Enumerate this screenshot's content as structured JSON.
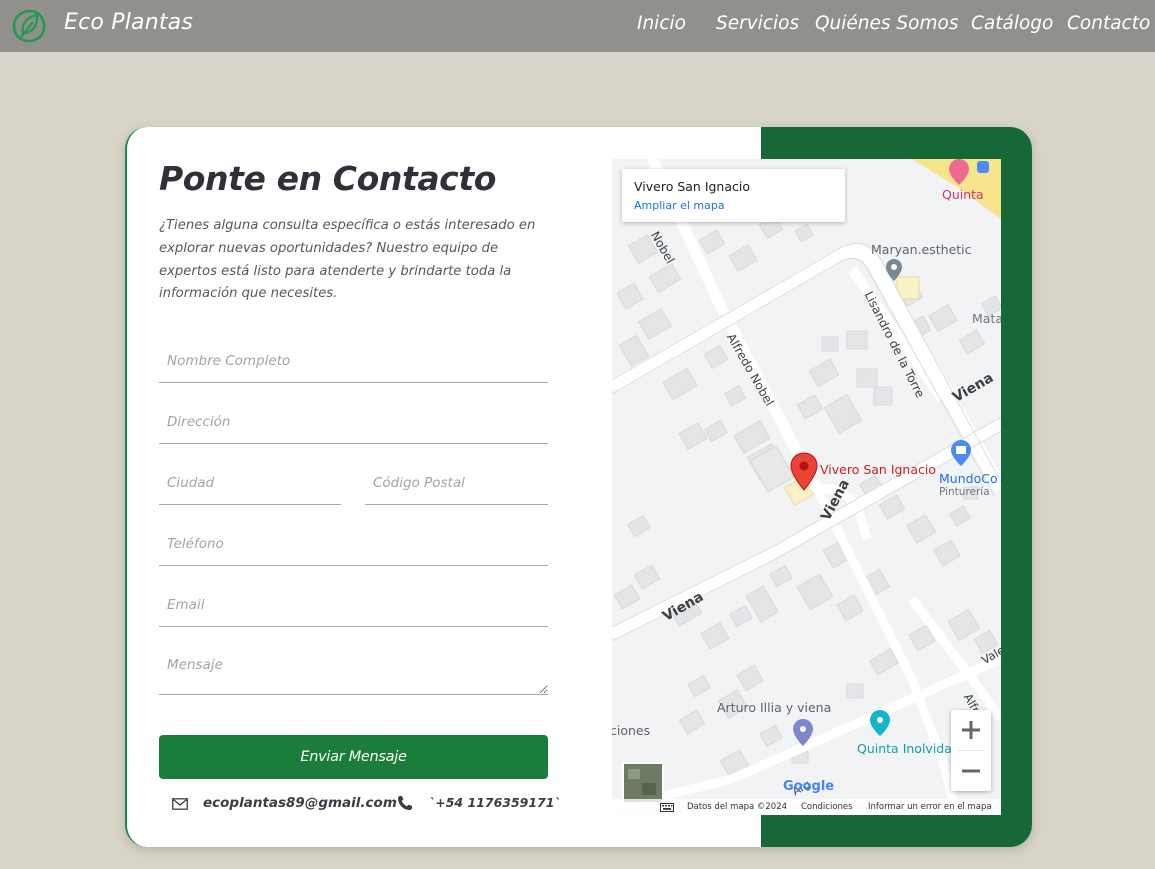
{
  "nav": {
    "brand": "Eco Plantas",
    "links": [
      "Inicio",
      "Servicios",
      "Quiénes Somos",
      "Catálogo",
      "Contacto"
    ]
  },
  "contact": {
    "title": "Ponte en Contacto",
    "intro": "¿Tienes alguna consulta específica o estás interesado en explorar nuevas oportunidades? Nuestro equipo de expertos está listo para atenderte y brindarte toda la información que necesites.",
    "form": {
      "name_placeholder": "Nombre Completo",
      "address_placeholder": "Dirección",
      "city_placeholder": "Ciudad",
      "postal_placeholder": "Código Postal",
      "phone_placeholder": "Teléfono",
      "email_placeholder": "Email",
      "message_placeholder": "Mensaje",
      "submit_label": "Enviar Mensaje"
    },
    "email": "ecoplantas89@gmail.com",
    "phone": "`+54 1176359171`"
  },
  "map": {
    "place_name": "Vivero San Ignacio",
    "expand_link": "Ampliar el mapa",
    "labels": {
      "quinta_top": "Quinta",
      "maryan": "Maryan.esthetic",
      "mata": "Mata",
      "nobel_top": "Nobel",
      "alfredo_nobel": "Alfredo Nobel",
      "lisandro": "Lisandro de la Torre",
      "viena_right": "Viena",
      "viena_mid": "Viena",
      "viena_left": "Viena",
      "pin_label": "Vivero San Ignacio",
      "mundoco": "MundoCo",
      "pintureria": "Pinturería",
      "vale": "Vale",
      "alfr": "Alfr",
      "arturo": "Arturo Illia y viena",
      "quinta_inolvida": "Quinta Inolvida",
      "ciones": "ciones",
      "arg": "Arg"
    },
    "footer": {
      "data": "Datos del mapa ©2024",
      "terms": "Condiciones",
      "report": "Informar un error en el mapa"
    },
    "google_logo": "Google",
    "colors": {
      "pin": "#ea4335",
      "road": "#ffffff",
      "block": "#e6e7e9"
    }
  },
  "colors": {
    "navbar": "#92908b",
    "background": "#d8d4ca",
    "accent": "#1a7d3c",
    "panel": "#166937"
  }
}
